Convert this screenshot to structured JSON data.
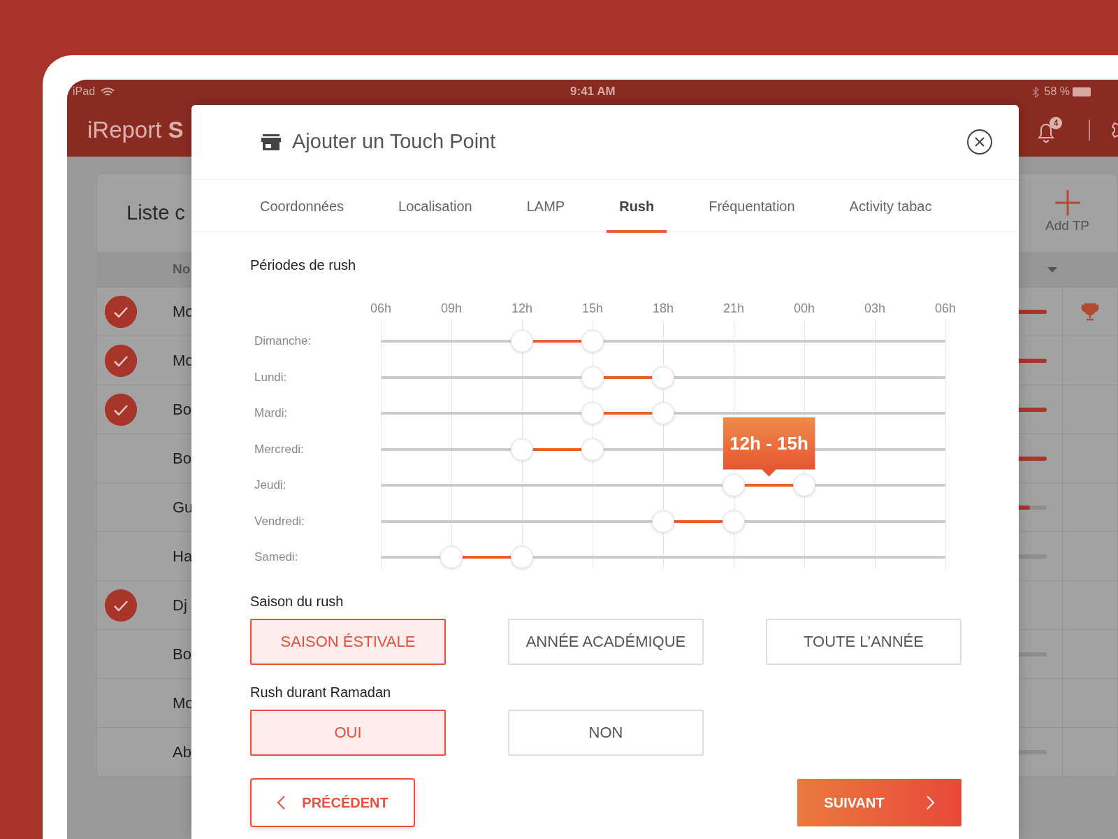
{
  "status_bar": {
    "device": "iPad",
    "time": "9:41 AM",
    "battery": "58 %"
  },
  "app_header": {
    "title": "iReport **S**",
    "notification_count": "4"
  },
  "background_list": {
    "title": "Liste c",
    "column_1": "No",
    "add_button": "Add TP",
    "rows": [
      {
        "name": "Mo",
        "checked": true,
        "level": 1,
        "trophy": true
      },
      {
        "name": "Mo",
        "checked": true,
        "level": 1,
        "trophy": false
      },
      {
        "name": "Bo",
        "checked": true,
        "level": 1,
        "trophy": false
      },
      {
        "name": "Bo",
        "checked": false,
        "level": 1,
        "trophy": false
      },
      {
        "name": "Gu",
        "checked": false,
        "level": 0.8,
        "trophy": false
      },
      {
        "name": "Ha",
        "checked": false,
        "level": 0,
        "trophy": false
      },
      {
        "name": "Dj",
        "checked": true,
        "trophy": false
      },
      {
        "name": "Bo",
        "checked": false,
        "level": 0,
        "trophy": false
      },
      {
        "name": "Mo",
        "checked": false,
        "trophy": false
      },
      {
        "name": "Ab",
        "checked": false,
        "level": 0,
        "trophy": false
      }
    ]
  },
  "modal": {
    "title": "Ajouter un Touch Point",
    "tabs": [
      {
        "label": "Coordonnées",
        "selected": false
      },
      {
        "label": "Localisation",
        "selected": false
      },
      {
        "label": "LAMP",
        "selected": false
      },
      {
        "label": "Rush",
        "selected": true
      },
      {
        "label": "Fréquentation",
        "selected": false
      },
      {
        "label": "Activity tabac",
        "selected": false
      }
    ],
    "rush": {
      "title": "Périodes de rush",
      "ticks": [
        "06h",
        "09h",
        "12h",
        "15h",
        "18h",
        "21h",
        "00h",
        "03h",
        "06h"
      ],
      "sliders": [
        {
          "day": "Dimanche:",
          "thumbs": [
            {
              "level": 0.25
            },
            {
              "level": 0.375
            }
          ]
        },
        {
          "day": "Lundi:",
          "thumbs": [
            {
              "level": 0.375
            },
            {
              "level": 0.5
            }
          ]
        },
        {
          "day": "Mardi:",
          "thumbs": [
            {
              "level": 0.375
            },
            {
              "level": 0.5
            }
          ]
        },
        {
          "day": "Mercredi:",
          "thumbs": [
            {
              "level": 0.25
            },
            {
              "level": 0.375
            }
          ]
        },
        {
          "day": "Jeudi:",
          "thumbs": [
            {
              "level": 0.625
            },
            {
              "level": 0.75
            }
          ],
          "tooltip": "12h - 15h"
        },
        {
          "day": "Vendredi:",
          "thumbs": [
            {
              "level": 0.5
            },
            {
              "level": 0.625
            }
          ]
        },
        {
          "day": "Samedi:",
          "thumbs": [
            {
              "level": 0.125
            },
            {
              "level": 0.25
            }
          ]
        }
      ]
    },
    "season": {
      "label": "Saison du rush",
      "options": [
        {
          "label": "SAISON ÉSTIVALE",
          "selected": true
        },
        {
          "label": "ANNÉE ACADÉMIQUE",
          "selected": false
        },
        {
          "label": "TOUTE L’ANNÉE",
          "selected": false
        }
      ]
    },
    "ramadan": {
      "label": "Rush durant Ramadan",
      "options": [
        {
          "label": "OUI",
          "selected": true
        },
        {
          "label": "NON",
          "selected": false
        }
      ]
    },
    "previous_button": "PRÉCÉDENT",
    "next_button": "SUIVANT"
  }
}
